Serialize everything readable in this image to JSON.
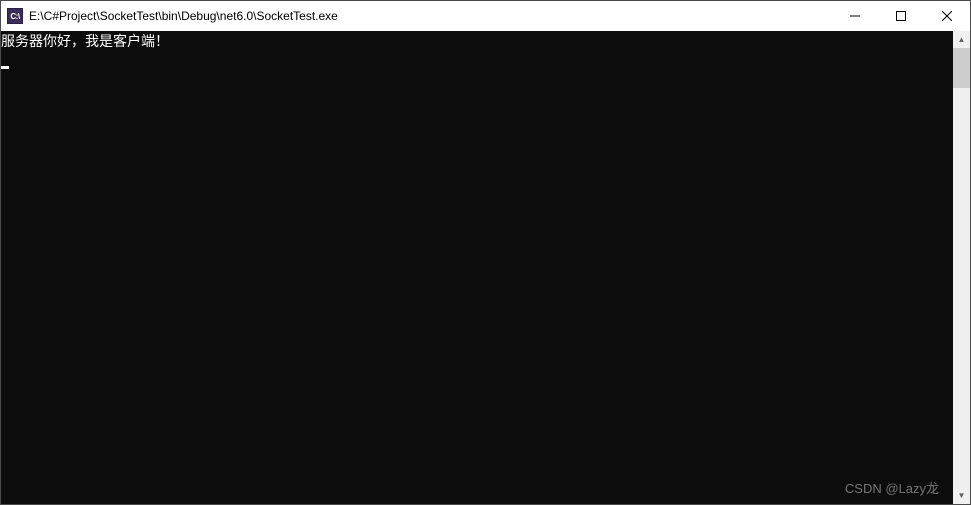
{
  "window": {
    "icon_label": "C:\\",
    "title": "E:\\C#Project\\SocketTest\\bin\\Debug\\net6.0\\SocketTest.exe"
  },
  "console": {
    "lines": [
      "服务器你好，我是客户端！"
    ]
  },
  "watermark": "CSDN @Lazy龙"
}
